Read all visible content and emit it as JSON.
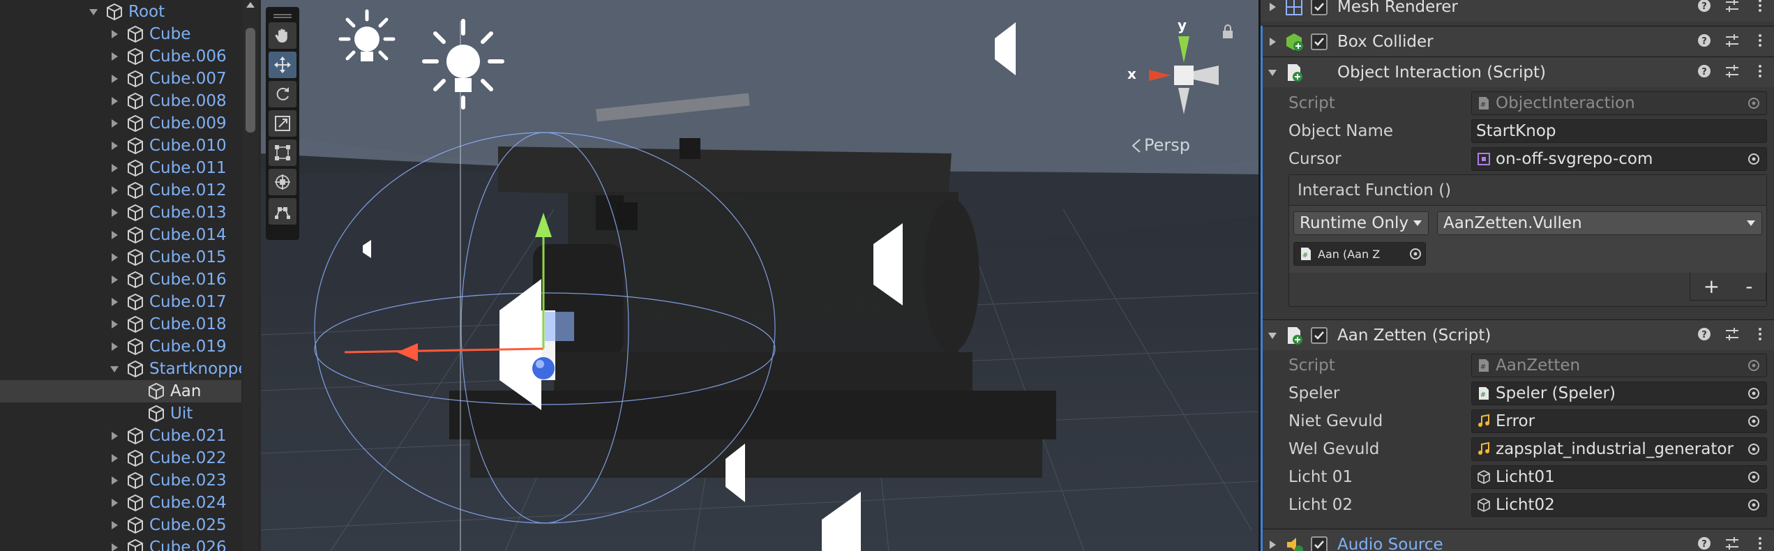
{
  "hierarchy": {
    "items": [
      {
        "label": "Root",
        "depth": 0,
        "expanded": true
      },
      {
        "label": "Cube",
        "depth": 1,
        "expanded": false
      },
      {
        "label": "Cube.006",
        "depth": 1,
        "expanded": false
      },
      {
        "label": "Cube.007",
        "depth": 1,
        "expanded": false
      },
      {
        "label": "Cube.008",
        "depth": 1,
        "expanded": false
      },
      {
        "label": "Cube.009",
        "depth": 1,
        "expanded": false
      },
      {
        "label": "Cube.010",
        "depth": 1,
        "expanded": false
      },
      {
        "label": "Cube.011",
        "depth": 1,
        "expanded": false
      },
      {
        "label": "Cube.012",
        "depth": 1,
        "expanded": false
      },
      {
        "label": "Cube.013",
        "depth": 1,
        "expanded": false
      },
      {
        "label": "Cube.014",
        "depth": 1,
        "expanded": false
      },
      {
        "label": "Cube.015",
        "depth": 1,
        "expanded": false
      },
      {
        "label": "Cube.016",
        "depth": 1,
        "expanded": false
      },
      {
        "label": "Cube.017",
        "depth": 1,
        "expanded": false
      },
      {
        "label": "Cube.018",
        "depth": 1,
        "expanded": false
      },
      {
        "label": "Cube.019",
        "depth": 1,
        "expanded": false
      },
      {
        "label": "Startknoppen",
        "depth": 1,
        "expanded": true
      },
      {
        "label": "Aan",
        "depth": 2,
        "selected": true
      },
      {
        "label": "Uit",
        "depth": 2
      },
      {
        "label": "Cube.021",
        "depth": 1,
        "expanded": false
      },
      {
        "label": "Cube.022",
        "depth": 1,
        "expanded": false
      },
      {
        "label": "Cube.023",
        "depth": 1,
        "expanded": false
      },
      {
        "label": "Cube.024",
        "depth": 1,
        "expanded": false
      },
      {
        "label": "Cube.025",
        "depth": 1,
        "expanded": false
      },
      {
        "label": "Cube.026",
        "depth": 1,
        "expanded": false
      }
    ]
  },
  "scene": {
    "persp_label": "Persp",
    "gizmo_x": "x",
    "gizmo_y": "y",
    "tools": [
      "hand-tool",
      "move-tool",
      "rotate-tool",
      "scale-tool",
      "rect-tool",
      "transform-tool",
      "custom-tool"
    ],
    "active_tool": "move-tool"
  },
  "inspector": {
    "mesh_renderer": {
      "title": "Mesh Renderer"
    },
    "box_collider": {
      "title": "Box Collider"
    },
    "object_interaction": {
      "title": "Object Interaction (Script)",
      "script_label": "Script",
      "script_value": "ObjectInteraction",
      "object_name_label": "Object Name",
      "object_name_value": "StartKnop",
      "cursor_label": "Cursor",
      "cursor_value": "on-off-svgrepo-com",
      "event_title": "Interact Function ()",
      "runtime_value": "Runtime Only",
      "function_value": "AanZetten.Vullen",
      "target_value": "Aan (Aan Z",
      "plus": "+",
      "minus": "-"
    },
    "aan_zetten": {
      "title": "Aan Zetten (Script)",
      "script_label": "Script",
      "script_value": "AanZetten",
      "speler_label": "Speler",
      "speler_value": "Speler (Speler)",
      "niet_gevuld_label": "Niet Gevuld",
      "niet_gevuld_value": "Error",
      "wel_gevuld_label": "Wel Gevuld",
      "wel_gevuld_value": "zapsplat_industrial_generator",
      "licht01_label": "Licht 01",
      "licht01_value": "Licht01",
      "licht02_label": "Licht 02",
      "licht02_value": "Licht02"
    },
    "audio_source": {
      "title": "Audio Source"
    }
  },
  "colors": {
    "accent": "#3d83d9",
    "hierarchy_text": "#7fb0f5",
    "selection": "#3e3e3e"
  }
}
